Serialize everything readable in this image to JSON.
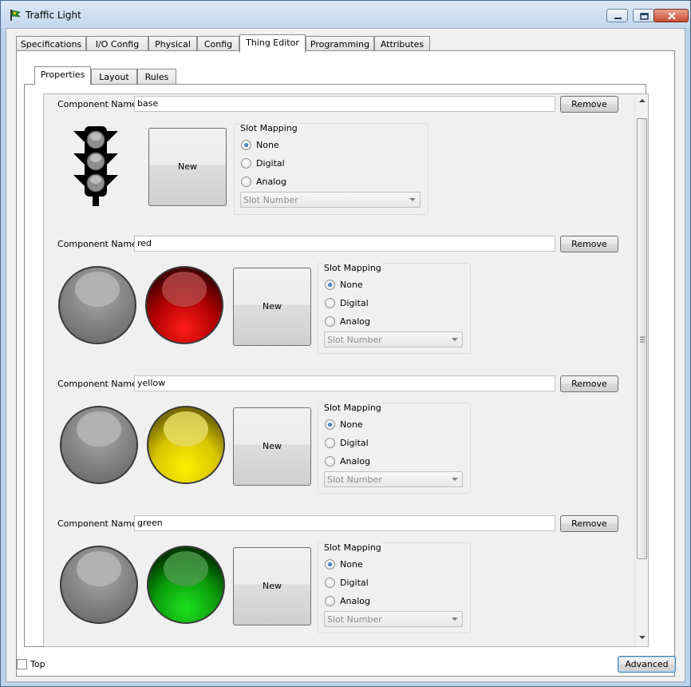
{
  "window": {
    "title": "Traffic Light"
  },
  "tabs": [
    "Specifications",
    "I/O Config",
    "Physical",
    "Config",
    "Thing Editor",
    "Programming",
    "Attributes"
  ],
  "active_tab": "Thing Editor",
  "subtabs": [
    "Properties",
    "Layout",
    "Rules"
  ],
  "active_subtab": "Properties",
  "component_label": "Component Name:",
  "remove_label": "Remove",
  "new_label": "New",
  "slot_mapping_title": "Slot Mapping",
  "slot_options": [
    "None",
    "Digital",
    "Analog"
  ],
  "slot_number_placeholder": "Slot Number",
  "components": [
    {
      "name": "base",
      "selected": "None"
    },
    {
      "name": "red",
      "selected": "None",
      "on_color": "#e00000"
    },
    {
      "name": "yellow",
      "selected": "None",
      "on_color": "#f2e400"
    },
    {
      "name": "green",
      "selected": "None",
      "on_color": "#13c313"
    }
  ],
  "bottom": {
    "top_checkbox_label": "Top",
    "top_checked": false,
    "advanced_label": "Advanced"
  },
  "colors": {
    "accent": "#3c7fb1",
    "off_light": "#8a8a8a"
  }
}
